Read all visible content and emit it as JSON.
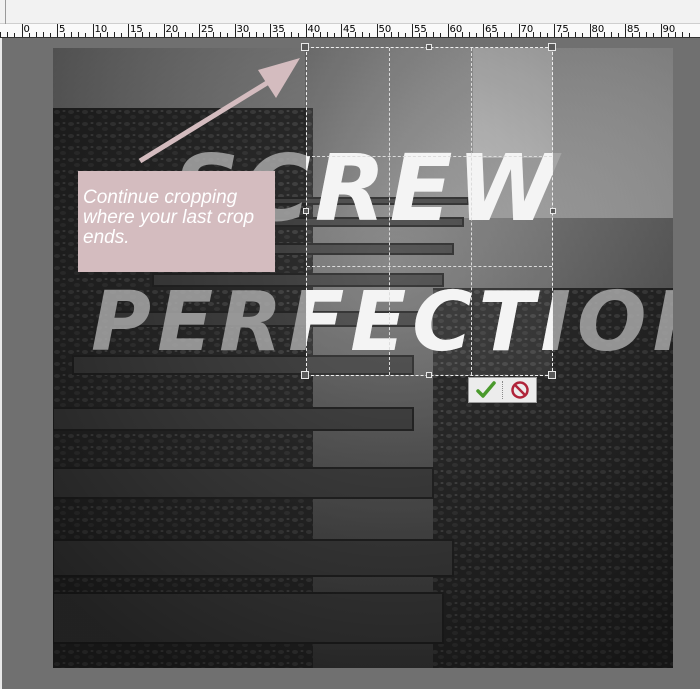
{
  "ruler": {
    "labels": [
      "5",
      "0",
      "5",
      "10",
      "15",
      "20",
      "25",
      "30",
      "35",
      "40",
      "45",
      "50",
      "55",
      "60",
      "65",
      "70",
      "75",
      "80",
      "85",
      "90"
    ]
  },
  "artwork": {
    "line1": "SCREW",
    "line2": "PERFECTION."
  },
  "callout": {
    "text": "Continue cropping where your last crop ends.",
    "color": "#d4bcbf",
    "arrow_color": "#d4bcbf"
  },
  "crop": {
    "commit_icon": "checkmark-icon",
    "cancel_icon": "cancel-icon",
    "commit_color": "#4a9a2c",
    "cancel_color": "#b0243a"
  },
  "canvas": {
    "background": "#707070"
  }
}
